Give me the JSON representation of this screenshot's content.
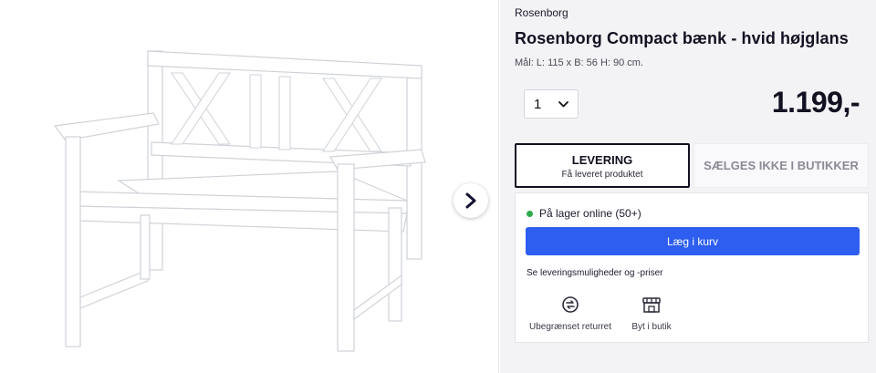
{
  "gallery": {
    "next_icon": "chevron-right-icon"
  },
  "product": {
    "brand": "Rosenborg",
    "title": "Rosenborg Compact bænk - hvid højglans",
    "dimensions": "Mål: L: 115 x B: 56 H: 90 cm.",
    "quantity": "1",
    "price": "1.199,-"
  },
  "tabs": {
    "delivery_title": "LEVERING",
    "delivery_subtitle": "Få leveret produktet",
    "store": "SÆLGES IKKE I BUTIKKER"
  },
  "card": {
    "stock": "På lager online (50+)",
    "add_to_cart": "Læg i kurv",
    "delivery_link": "Se leveringsmuligheder og -priser",
    "features": [
      {
        "label": "Ubegrænset returret",
        "icon": "return-arrows-icon"
      },
      {
        "label": "Byt i butik",
        "icon": "store-icon"
      }
    ]
  },
  "colors": {
    "accent": "#2d5ef0",
    "stock": "#2eaa4a",
    "text": "#111122"
  }
}
